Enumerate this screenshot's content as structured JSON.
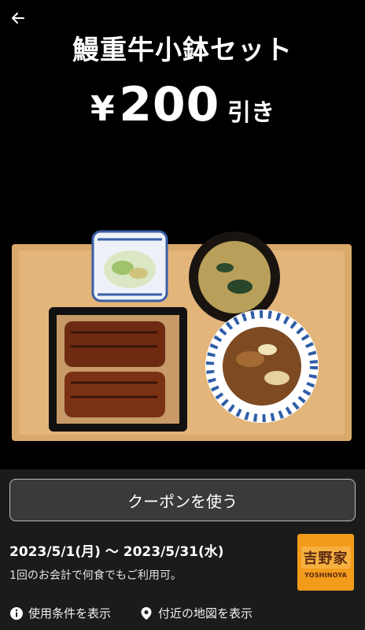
{
  "header": {
    "title": "鰻重牛小鉢セット",
    "price_prefix": "¥",
    "price_amount": "200",
    "price_suffix": "引き"
  },
  "coupon": {
    "use_button_label": "クーポンを使う",
    "valid_dates": "2023/5/1(月) 〜 2023/5/31(水)",
    "usage_note": "1回のお会計で何食でもご利用可。",
    "brand_logo_text": "吉野家",
    "brand_logo_roman": "YOSHINOYA"
  },
  "links": {
    "terms_label": "使用条件を表示",
    "map_label": "付近の地図を表示"
  },
  "icons": {
    "back": "back-arrow-icon",
    "info": "info-icon",
    "location": "location-pin-icon"
  },
  "colors": {
    "background": "#000000",
    "panel": "#1b1b1b",
    "button_bg": "#3a3a3a",
    "logo_orange": "#f39b1b"
  }
}
